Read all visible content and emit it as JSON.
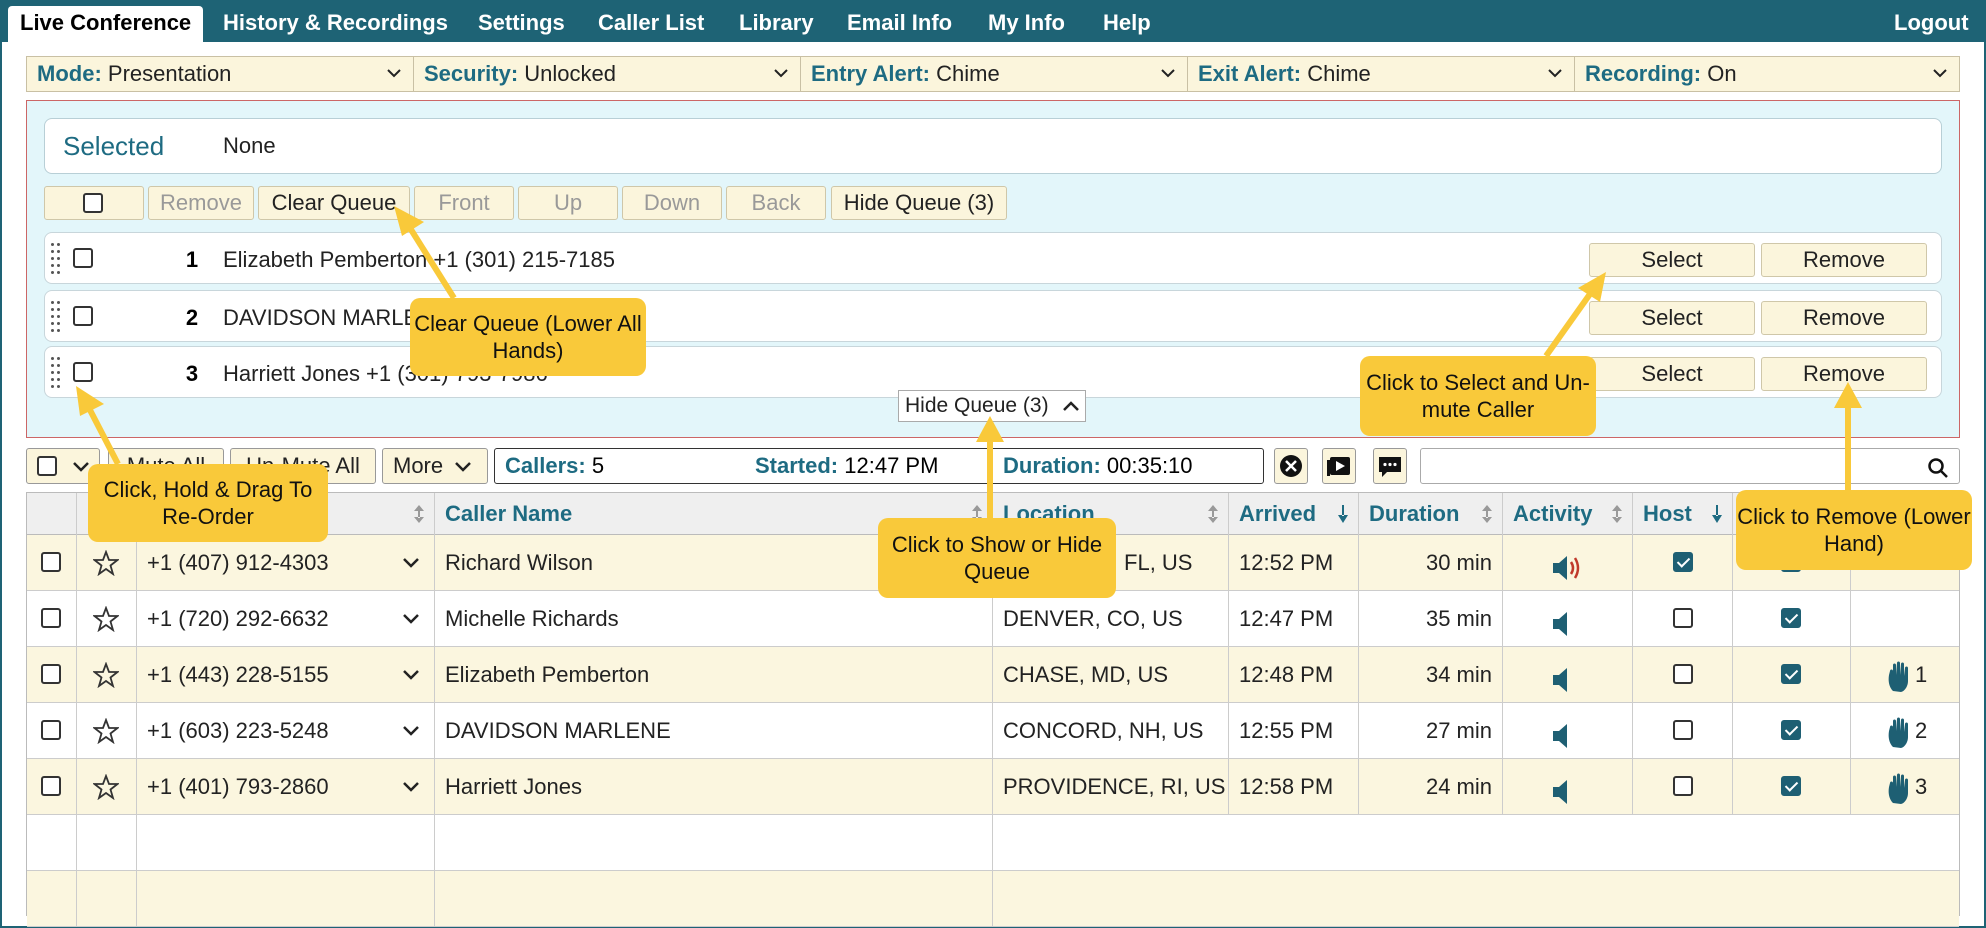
{
  "nav": {
    "tabs": [
      "Live Conference",
      "History & Recordings",
      "Settings",
      "Caller List",
      "Library",
      "Email Info",
      "My Info",
      "Help"
    ],
    "logout": "Logout"
  },
  "modebar": [
    {
      "key": "Mode:",
      "value": "Presentation"
    },
    {
      "key": "Security:",
      "value": "Unlocked"
    },
    {
      "key": "Entry Alert:",
      "value": "Chime"
    },
    {
      "key": "Exit Alert:",
      "value": "Chime"
    },
    {
      "key": "Recording:",
      "value": "On"
    }
  ],
  "queue": {
    "selected_label": "Selected",
    "selected_value": "None",
    "buttons": [
      "Remove",
      "Clear Queue",
      "Front",
      "Up",
      "Down",
      "Back",
      "Hide Queue (3)"
    ],
    "rows": [
      {
        "num": "1",
        "text": "Elizabeth Pemberton +1 (301) 215-7185"
      },
      {
        "num": "2",
        "text": "DAVIDSON MARLENE +1 (603) 223-5248"
      },
      {
        "num": "3",
        "text": "Harriett Jones +1 (301) 793-7986"
      }
    ],
    "select_label": "Select",
    "remove_label": "Remove",
    "hide_toggle": "Hide Queue (3)"
  },
  "toolbar": {
    "mute_all": "Mute All",
    "unmute_all": "Un-Mute All",
    "more": "More",
    "callers_key": "Callers:",
    "callers_val": "5",
    "started_key": "Started:",
    "started_val": "12:47 PM",
    "duration_key": "Duration:",
    "duration_val": "00:35:10"
  },
  "table": {
    "headers": {
      "caller_name": "Caller Name",
      "location": "Location",
      "arrived": "Arrived",
      "duration": "Duration",
      "activity": "Activity",
      "host": "Host"
    },
    "rows": [
      {
        "phone": "+1 (407) 912-4303",
        "name": "Richard Wilson",
        "location": "ORLANDO, FL, US",
        "arrived": "12:52 PM",
        "duration": "30 min",
        "speaking": true,
        "host": true,
        "listen": true,
        "hand": ""
      },
      {
        "phone": "+1 (720) 292-6632",
        "name": "Michelle Richards",
        "location": "DENVER, CO, US",
        "arrived": "12:47 PM",
        "duration": "35 min",
        "speaking": false,
        "host": false,
        "listen": true,
        "hand": ""
      },
      {
        "phone": "+1 (443) 228-5155",
        "name": "Elizabeth Pemberton",
        "location": "CHASE, MD, US",
        "arrived": "12:48 PM",
        "duration": "34 min",
        "speaking": false,
        "host": false,
        "listen": true,
        "hand": "1"
      },
      {
        "phone": "+1 (603) 223-5248",
        "name": "DAVIDSON MARLENE",
        "location": "CONCORD, NH, US",
        "arrived": "12:55 PM",
        "duration": "27 min",
        "speaking": false,
        "host": false,
        "listen": true,
        "hand": "2"
      },
      {
        "phone": "+1 (401) 793-2860",
        "name": "Harriett Jones",
        "location": "PROVIDENCE, RI, US",
        "arrived": "12:58 PM",
        "duration": "24 min",
        "speaking": false,
        "host": false,
        "listen": true,
        "hand": "3"
      }
    ]
  },
  "callouts": {
    "clear_queue": "Clear Queue (Lower All Hands)",
    "reorder": "Click, Hold & Drag To Re-Order",
    "show_hide": "Click to Show or Hide Queue",
    "select_unmute": "Click to Select and Un-mute Caller",
    "remove": "Click to Remove (Lower Hand)"
  },
  "colors": {
    "brand": "#1e6375",
    "accent": "#f9c93a",
    "row_alt": "#fbf6df",
    "queue_bg": "#e3f6fa"
  }
}
